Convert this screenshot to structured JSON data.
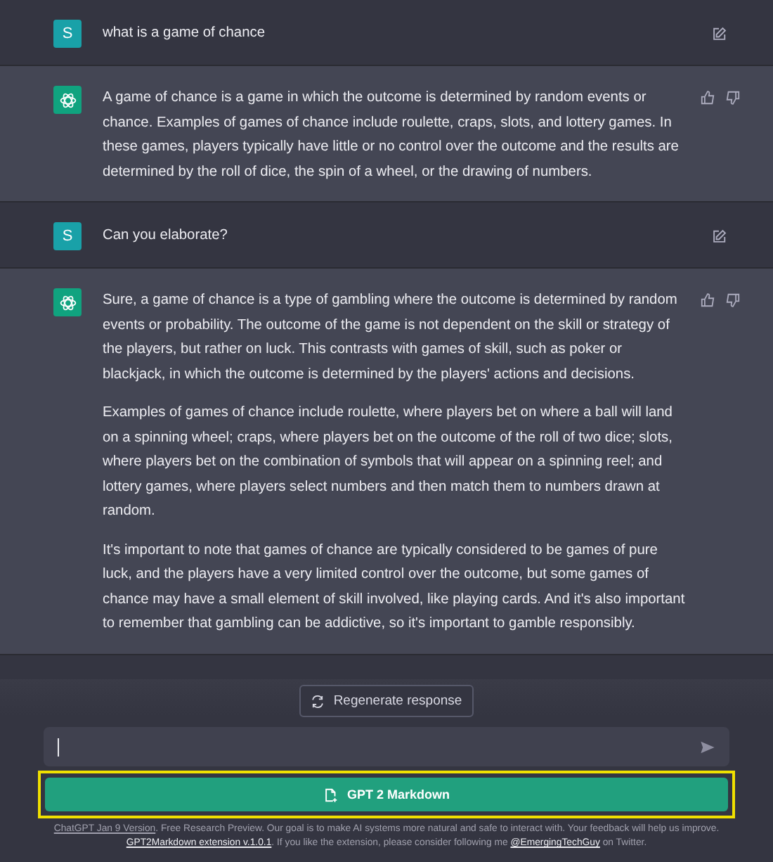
{
  "messages": [
    {
      "kind": "user",
      "avatar": "S",
      "paragraphs": [
        "what is a game of chance"
      ]
    },
    {
      "kind": "assistant",
      "paragraphs": [
        "A game of chance is a game in which the outcome is determined by random events or chance. Examples of games of chance include roulette, craps, slots, and lottery games. In these games, players typically have little or no control over the outcome and the results are determined by the roll of dice, the spin of a wheel, or the drawing of numbers."
      ]
    },
    {
      "kind": "user",
      "avatar": "S",
      "paragraphs": [
        "Can you elaborate?"
      ]
    },
    {
      "kind": "assistant",
      "paragraphs": [
        "Sure, a game of chance is a type of gambling where the outcome is determined by random events or probability. The outcome of the game is not dependent on the skill or strategy of the players, but rather on luck. This contrasts with games of skill, such as poker or blackjack, in which the outcome is determined by the players' actions and decisions.",
        "Examples of games of chance include roulette, where players bet on where a ball will land on a spinning wheel; craps, where players bet on the outcome of the roll of two dice; slots, where players bet on the combination of symbols that will appear on a spinning reel; and lottery games, where players select numbers and then match them to numbers drawn at random.",
        "It's important to note that games of chance are typically considered to be games of pure luck, and the players have a very limited control over the outcome, but some games of chance may have a small element of skill involved, like playing cards. And it's also important to remember that gambling can be addictive, so it's important to gamble responsibly."
      ]
    }
  ],
  "regenerate_button": "Regenerate response",
  "markdown_button": "GPT 2 Markdown",
  "footer": [
    [
      {
        "text": "ChatGPT Jan 9 Version",
        "link": true
      },
      {
        "text": ". Free Research Preview. Our goal is to make AI systems more natural and safe to interact with. Your feedback will help us improve.",
        "link": false
      }
    ],
    [
      {
        "text": "GPT2Markdown extension v.1.0.1",
        "link": true
      },
      {
        "text": ". If you like the extension, please consider following me ",
        "link": false
      },
      {
        "text": "@EmergingTechGuy",
        "link": true
      },
      {
        "text": " on Twitter.",
        "link": false
      }
    ]
  ]
}
